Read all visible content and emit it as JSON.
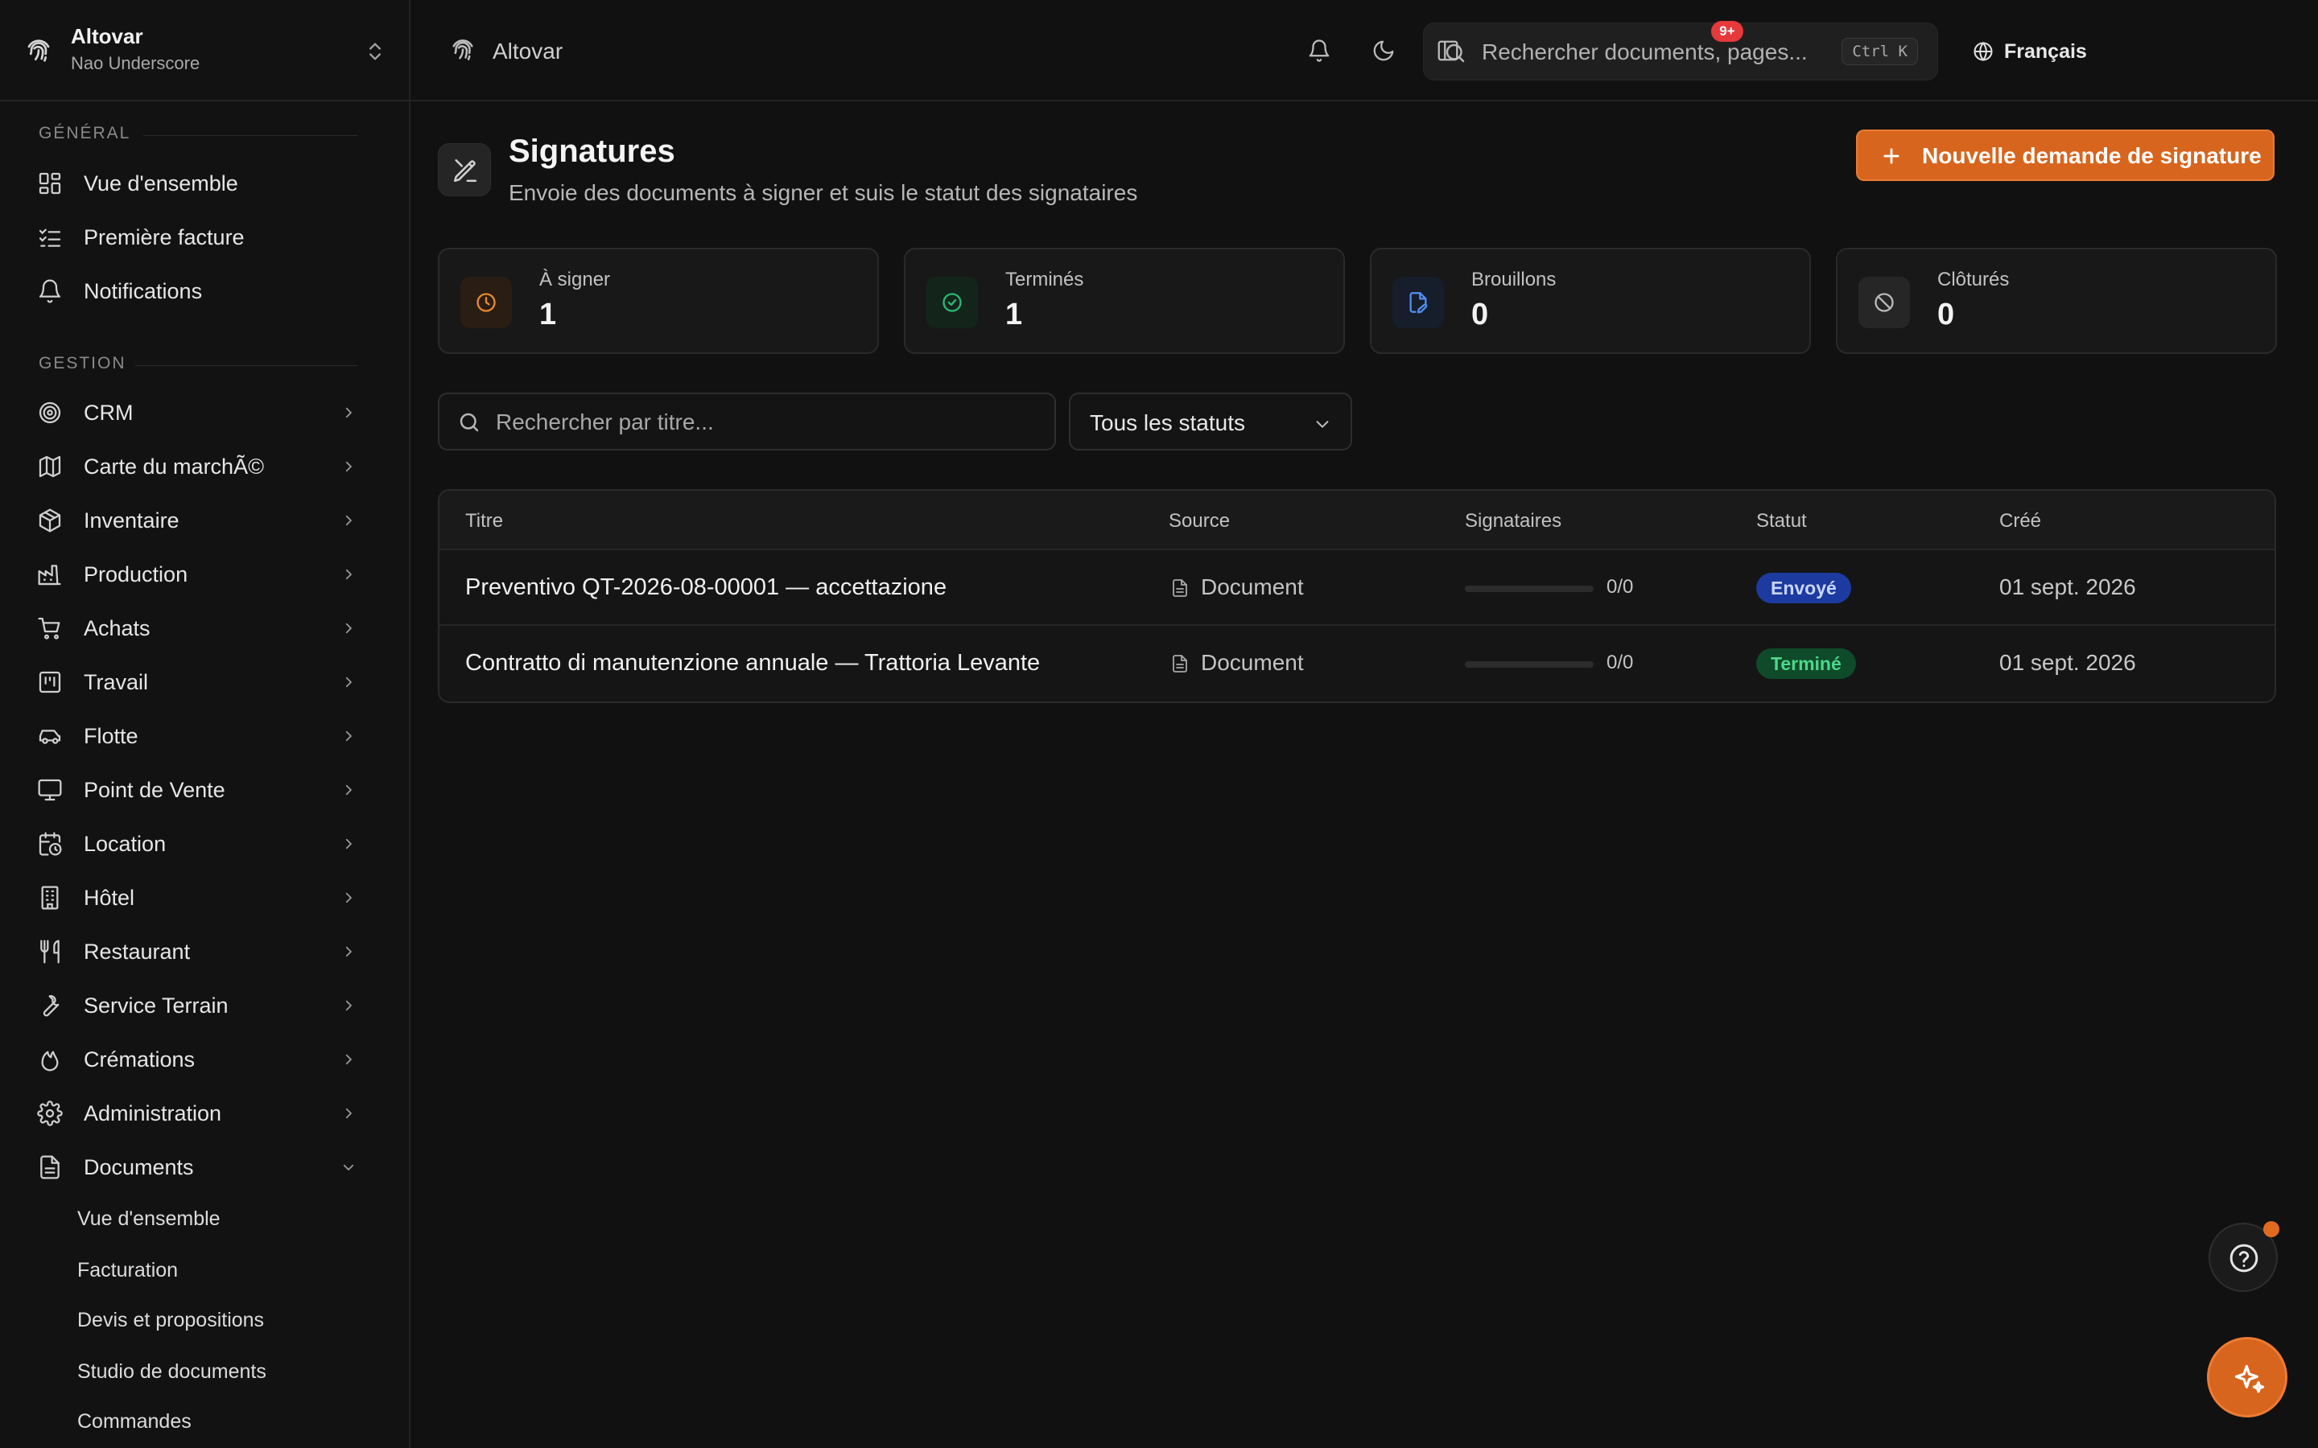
{
  "sidebar": {
    "org_name": "Altovar",
    "user_name": "Nao Underscore",
    "section_general": "GÉNÉRAL",
    "general_items": [
      {
        "label": "Vue d'ensemble",
        "icon": "dashboard-icon"
      },
      {
        "label": "Première facture",
        "icon": "checklist-icon"
      },
      {
        "label": "Notifications",
        "icon": "bell-icon"
      }
    ],
    "section_management": "GESTION",
    "management_items": [
      {
        "label": "CRM",
        "icon": "target-icon"
      },
      {
        "label": "Carte du marchÃ©",
        "icon": "map-icon"
      },
      {
        "label": "Inventaire",
        "icon": "box-icon"
      },
      {
        "label": "Production",
        "icon": "factory-icon"
      },
      {
        "label": "Achats",
        "icon": "cart-icon"
      },
      {
        "label": "Travail",
        "icon": "kanban-icon"
      },
      {
        "label": "Flotte",
        "icon": "car-icon"
      },
      {
        "label": "Point de Vente",
        "icon": "monitor-icon"
      },
      {
        "label": "Location",
        "icon": "calendar-clock-icon"
      },
      {
        "label": "Hôtel",
        "icon": "building-icon"
      },
      {
        "label": "Restaurant",
        "icon": "utensils-icon"
      },
      {
        "label": "Service Terrain",
        "icon": "wrench-icon"
      },
      {
        "label": "Crémations",
        "icon": "flame-icon"
      },
      {
        "label": "Administration",
        "icon": "gear-icon"
      },
      {
        "label": "Documents",
        "icon": "file-icon"
      }
    ],
    "documents_subitems": [
      "Vue d'ensemble",
      "Facturation",
      "Devis et propositions",
      "Studio de documents",
      "Commandes"
    ]
  },
  "header": {
    "breadcrumb": "Altovar",
    "search_placeholder": "Rechercher documents, pages...",
    "search_shortcut": "Ctrl K",
    "language": "Français",
    "notification_badge": "9+"
  },
  "page": {
    "title": "Signatures",
    "subtitle": "Envoie des documents à signer et suis le statut des signataires",
    "new_button": "Nouvelle demande de signature"
  },
  "stats": [
    {
      "label": "À signer",
      "value": "1",
      "icon": "clock-icon",
      "color": "#e8892e",
      "bg": "#2a1d14"
    },
    {
      "label": "Terminés",
      "value": "1",
      "icon": "check-circle-icon",
      "color": "#2bb673",
      "bg": "#13251b"
    },
    {
      "label": "Brouillons",
      "value": "0",
      "icon": "file-signature-icon",
      "color": "#4f8ff0",
      "bg": "#161d2b"
    },
    {
      "label": "Clôturés",
      "value": "0",
      "icon": "ban-icon",
      "color": "#b9b9b9",
      "bg": "#262626"
    }
  ],
  "filters": {
    "search_placeholder": "Rechercher par titre...",
    "status_value": "Tous les statuts"
  },
  "table": {
    "columns": [
      "Titre",
      "Source",
      "Signataires",
      "Statut",
      "Créé"
    ],
    "rows": [
      {
        "title": "Preventivo QT-2026-08-00001 — accettazione",
        "source": "Document",
        "signers": "0/0",
        "progress": 0,
        "status": "Envoyé",
        "created": "01 sept. 2026"
      },
      {
        "title": "Contratto di manutenzione annuale — Trattoria Levante",
        "source": "Document",
        "signers": "0/0",
        "progress": 0,
        "status": "Terminé",
        "created": "01 sept. 2026"
      }
    ]
  },
  "colors": {
    "accent": "#d8651d",
    "status_sent_bg": "#1d3aa0",
    "status_sent_fg": "#c9d6ff",
    "status_done_bg": "#0f4a2a",
    "status_done_fg": "#4ad98a",
    "notification_red": "#e5393b"
  }
}
